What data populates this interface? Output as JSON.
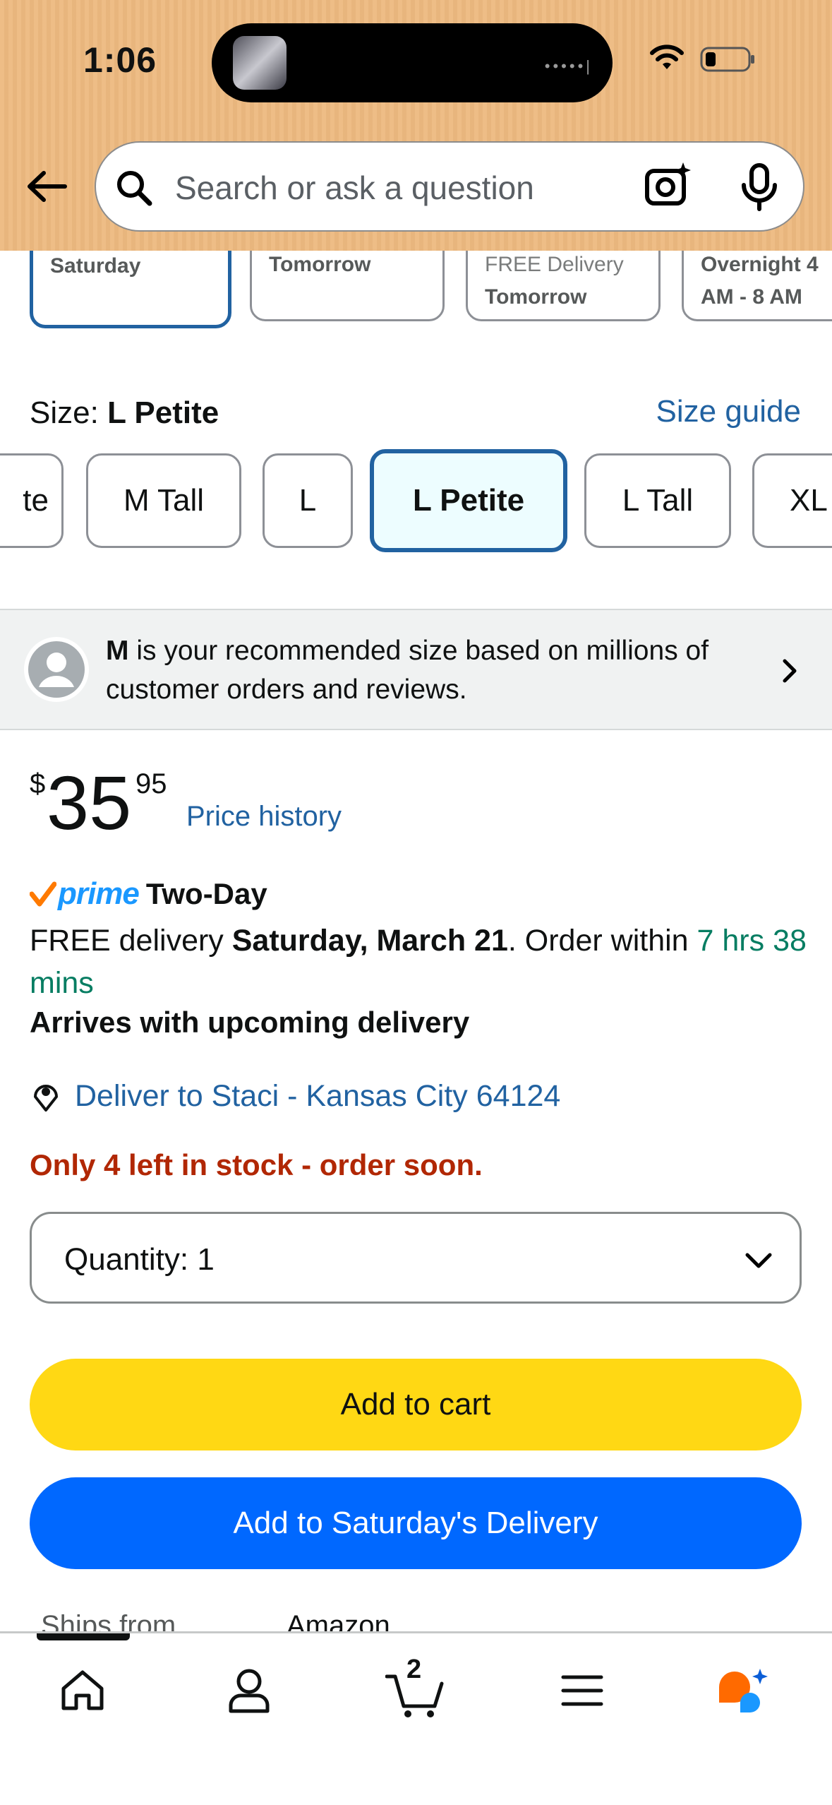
{
  "status_bar": {
    "time": "1:06"
  },
  "header": {
    "search_placeholder": "Search or ask a question"
  },
  "delivery_options": [
    {
      "line1": "",
      "line2": "Saturday",
      "selected": true
    },
    {
      "line1": "",
      "line2": "Tomorrow",
      "selected": false
    },
    {
      "line1": "FREE Delivery",
      "line2": "Tomorrow",
      "selected": false
    },
    {
      "line1": "Overnight 4",
      "line2": "AM - 8 AM",
      "selected": false
    }
  ],
  "size": {
    "label": "Size:",
    "selected_value": "L Petite",
    "guide_link": "Size guide",
    "options": [
      "te",
      "M Tall",
      "L",
      "L Petite",
      "L Tall",
      "XL"
    ]
  },
  "recommendation": {
    "size": "M",
    "text": " is your recommended size based on millions of customer orders and reviews."
  },
  "price": {
    "symbol": "$",
    "whole": "35",
    "fraction": "95",
    "history_link": "Price history"
  },
  "prime": {
    "brand": "prime",
    "speed": "Two-Day"
  },
  "delivery": {
    "prefix": "FREE delivery ",
    "date": "Saturday, March 21",
    "middle": ". Order within ",
    "countdown": "7 hrs 38 mins",
    "arrives": "Arrives with upcoming delivery",
    "deliver_to": "Deliver to Staci - Kansas City 64124"
  },
  "stock_warning": "Only 4 left in stock - order soon.",
  "quantity": {
    "label": "Quantity:",
    "value": "1"
  },
  "buttons": {
    "add_to_cart": "Add to cart",
    "add_to_delivery": "Add to Saturday's Delivery"
  },
  "ships_from": {
    "label": "Ships from",
    "value": "Amazon"
  },
  "bottom_nav": {
    "cart_count": "2"
  },
  "colors": {
    "header_bg": "#edb97f",
    "link": "#2162a1",
    "cart_button": "#ffd814",
    "delivery_button": "#0068ff",
    "stock_red": "#b12704",
    "countdown_green": "#067d62",
    "prime_blue": "#1a98ff"
  }
}
